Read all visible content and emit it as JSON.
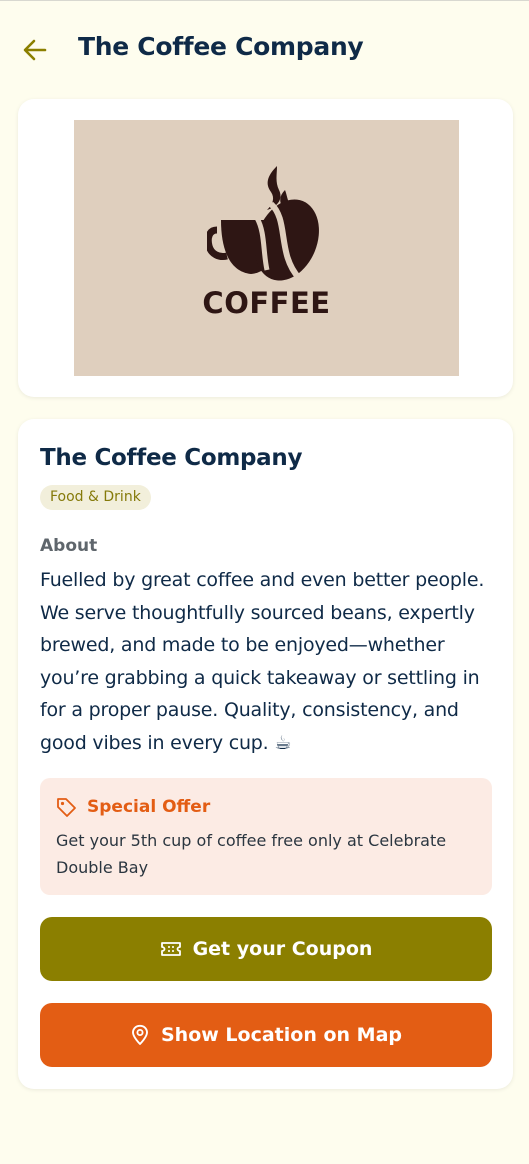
{
  "header": {
    "title": "The Coffee Company",
    "back_icon": "arrow-left-icon",
    "back_color": "#8b7f00"
  },
  "logo": {
    "text": "COFFEE",
    "icon": "coffee-cup-bean-icon",
    "background": "#dfcfbe",
    "ink": "#2e1614"
  },
  "business": {
    "name": "The Coffee Company",
    "category": "Food & Drink",
    "about_label": "About",
    "about_text": "Fuelled by great coffee and even better people. We serve thoughtfully sourced beans, expertly brewed, and made to be enjoyed—whether you’re grabbing a quick takeaway or settling in for a proper pause. Quality, consistency, and good vibes in every cup. ☕"
  },
  "offer": {
    "icon": "tag-icon",
    "title": "Special Offer",
    "text": "Get your 5th cup of coffee free only at Celebrate Double Bay",
    "background": "#fcebe4",
    "accent": "#e35d14"
  },
  "actions": {
    "coupon_label": "Get your Coupon",
    "coupon_icon": "ticket-icon",
    "coupon_color": "#8b7f00",
    "map_label": "Show Location on Map",
    "map_icon": "map-pin-icon",
    "map_color": "#e35d14"
  }
}
